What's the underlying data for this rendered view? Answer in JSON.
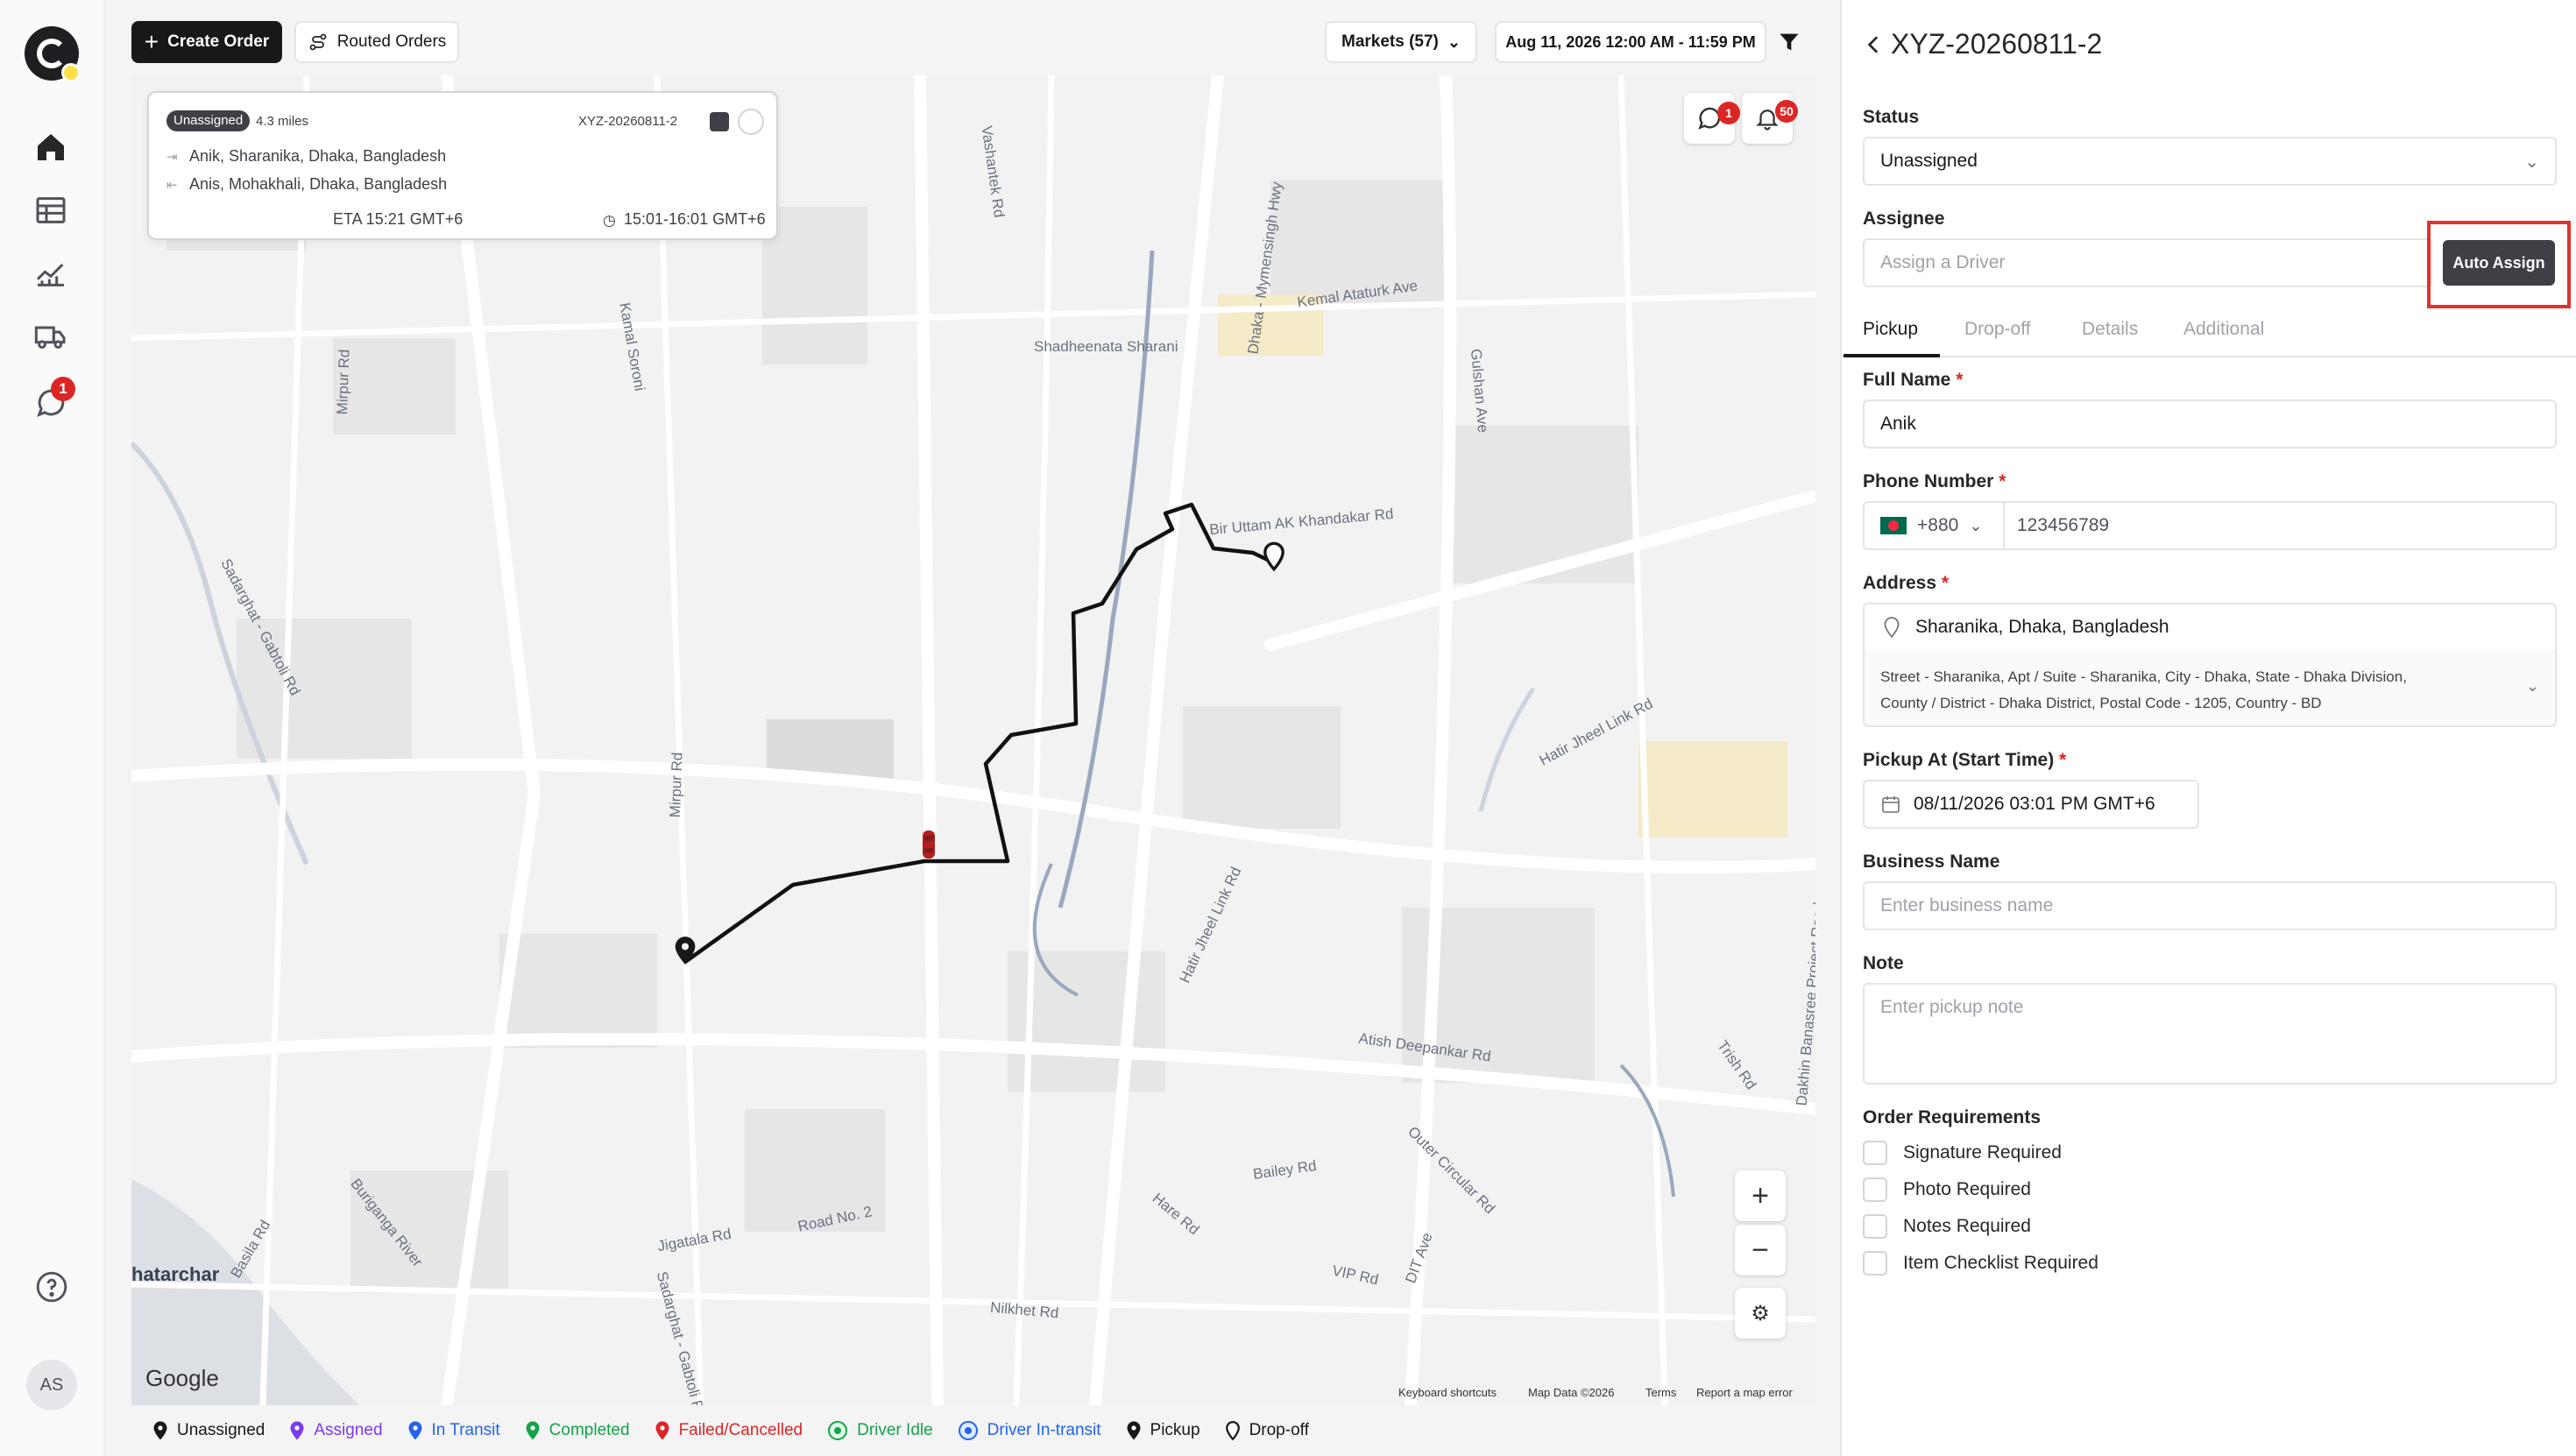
{
  "toolbar": {
    "create_order": "Create Order",
    "routed_orders": "Routed Orders",
    "markets": "Markets (57)",
    "date_range": "Aug 11, 2026 12:00 AM - 11:59 PM"
  },
  "sidebar": {
    "messages_badge": "1",
    "avatar_initials": "AS",
    "icons": [
      "home-icon",
      "table-icon",
      "analytics-icon",
      "truck-icon",
      "chat-icon",
      "help-icon"
    ]
  },
  "order_card": {
    "status": "Unassigned",
    "distance": "4.3 miles",
    "order_id": "XYZ-20260811-2",
    "pickup_address": "Anik, Sharanika, Dhaka, Bangladesh",
    "dropoff_address": "Anis, Mohakhali, Dhaka, Bangladesh",
    "eta": "ETA 15:21 GMT+6",
    "window": "15:01-16:01 GMT+6"
  },
  "map": {
    "chat_badge": "1",
    "bell_badge": "50",
    "zoom_in": "+",
    "zoom_out": "−",
    "google": "Google",
    "footer": {
      "shortcuts": "Keyboard shortcuts",
      "mapdata": "Map Data ©2026",
      "terms": "Terms",
      "report": "Report a map error"
    },
    "labels": {
      "mymensingh": "Dhaka - Mymensingh Hwy",
      "kemal": "Kemal Ataturk Ave",
      "shadheenata": "Shadheenata Sharani",
      "gulshan": "Gulshan Ave",
      "birUttam": "Bir Uttam AK Khandakar Rd",
      "mirpur1": "Mirpur Rd",
      "mirpur2": "Mirpur Rd",
      "kamalSoroni": "Kamal Soroni",
      "vashantek": "Vashantek Rd",
      "sadarghat": "Sadarghat - Gabtoli Rd",
      "hatirjheel1": "Hatir Jheel Link Rd",
      "hatirjheel2": "Hatir Jheel Link Rd",
      "atish": "Atish Deepankar Rd",
      "baileyRd": "Bailey Rd",
      "outerCircular": "Outer Circular Rd",
      "hare": "Hare Rd",
      "vip": "VIP Rd",
      "dit": "DIT Ave",
      "buriganga": "Buriganga River",
      "road2": "Road No. 2",
      "jigatala": "Jigatala Rd",
      "nilkhet": "Nilkhet Rd",
      "basila": "Basila Rd",
      "hatarchar": "hatarchar",
      "trishRd": "Trish Rd",
      "dakhin": "Dakhin Banasree Project Road",
      "sadarghat2": "Sadarghat - Gabtoli Rd"
    }
  },
  "legend": [
    {
      "label": "Unassigned",
      "color": "#18181b"
    },
    {
      "label": "Assigned",
      "color": "#7c3aed"
    },
    {
      "label": "In Transit",
      "color": "#2563eb"
    },
    {
      "label": "Completed",
      "color": "#16a34a"
    },
    {
      "label": "Failed/Cancelled",
      "color": "#dc2626"
    },
    {
      "label": "Driver Idle",
      "color": "#16a34a"
    },
    {
      "label": "Driver In-transit",
      "color": "#2563eb"
    },
    {
      "label": "Pickup",
      "color": "#18181b"
    },
    {
      "label": "Drop-off",
      "color": "#18181b"
    }
  ],
  "panel": {
    "title": "XYZ-20260811-2",
    "status_label": "Status",
    "status_value": "Unassigned",
    "assignee_label": "Assignee",
    "assignee_placeholder": "Assign a Driver",
    "auto_assign": "Auto Assign",
    "tabs": [
      "Pickup",
      "Drop-off",
      "Details",
      "Additional"
    ],
    "full_name_label": "Full Name",
    "full_name_value": "Anik",
    "phone_label": "Phone Number",
    "phone_code": "+880",
    "phone_value": "123456789",
    "address_label": "Address",
    "address_value": "Sharanika, Dhaka, Bangladesh",
    "address_detail_1": "Street - Sharanika, Apt / Suite - Sharanika, City - Dhaka, State - Dhaka Division,",
    "address_detail_2": "County / District - Dhaka District, Postal Code - 1205, Country - BD",
    "pickup_at_label": "Pickup At (Start Time)",
    "pickup_at_value": "08/11/2026 03:01 PM GMT+6",
    "business_label": "Business Name",
    "business_placeholder": "Enter business name",
    "note_label": "Note",
    "note_placeholder": "Enter pickup note",
    "requirements_label": "Order Requirements",
    "requirements": [
      "Signature Required",
      "Photo Required",
      "Notes Required",
      "Item Checklist Required"
    ],
    "required_mark": "*"
  }
}
